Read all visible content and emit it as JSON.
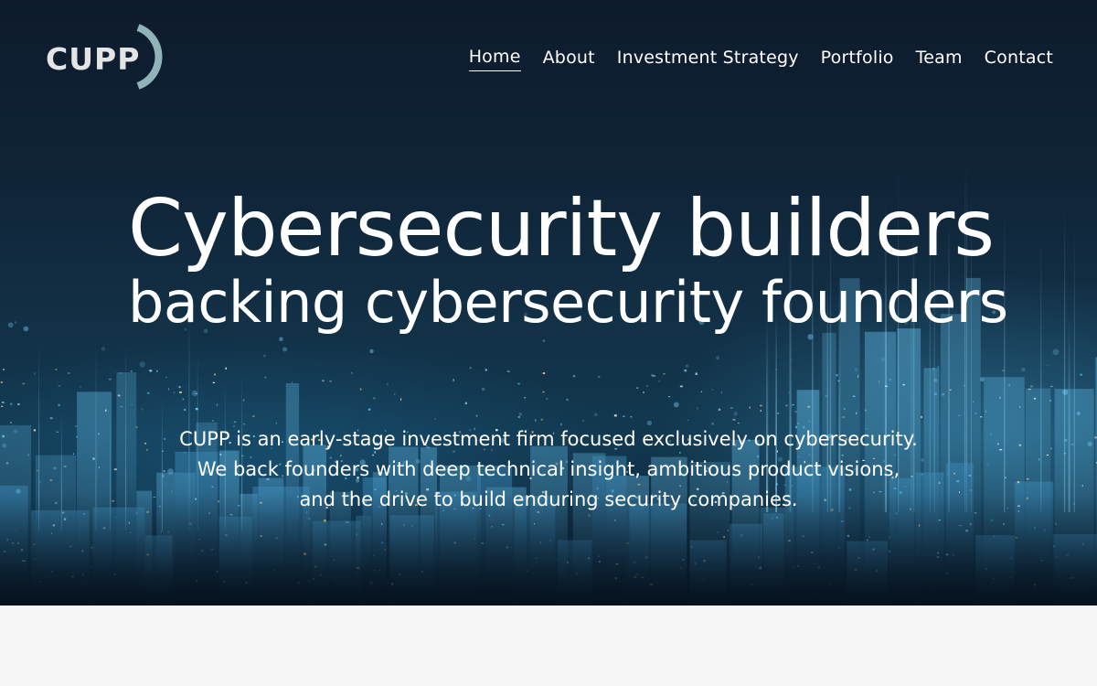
{
  "brand": {
    "logo_text": "CUPP",
    "logo_text_color": "#e4e4e4",
    "logo_arc_color": "#8fb3b8"
  },
  "nav": {
    "items": [
      {
        "label": "Home",
        "active": true
      },
      {
        "label": "About",
        "active": false
      },
      {
        "label": "Investment Strategy",
        "active": false
      },
      {
        "label": "Portfolio",
        "active": false
      },
      {
        "label": "Team",
        "active": false
      },
      {
        "label": "Contact",
        "active": false
      }
    ]
  },
  "hero": {
    "title_line1": "Cybersecurity builders",
    "title_line2": "backing cybersecurity founders",
    "description_lines": [
      "CUPP is an early-stage investment firm focused exclusively on cybersecurity.",
      "We back founders with deep technical insight, ambitious product visions,",
      "and the drive to build enduring security companies."
    ],
    "background_theme": "night-city-skyline",
    "accent_color": "#4fb8e8"
  },
  "colors": {
    "text": "#ffffff",
    "page_background": "#f6f6f6",
    "hero_dark": "#0d1b2c"
  }
}
